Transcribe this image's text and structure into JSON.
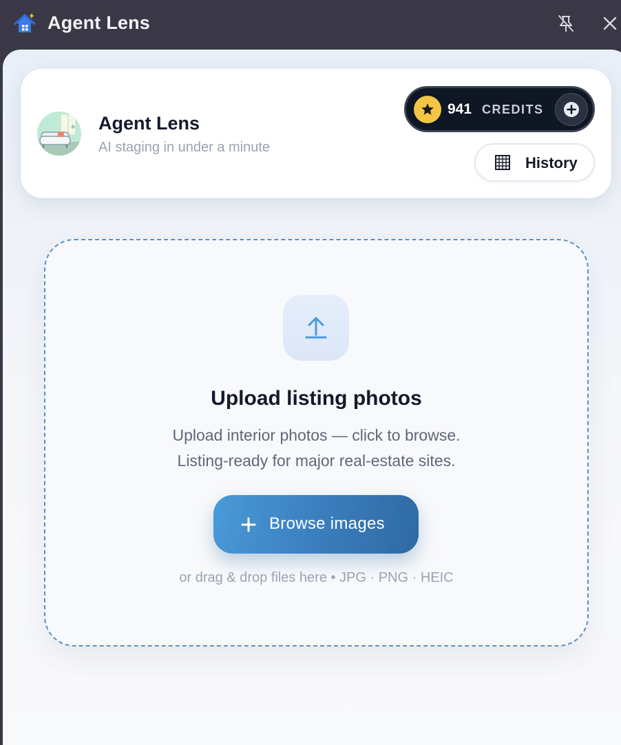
{
  "window": {
    "title": "Agent Lens"
  },
  "header": {
    "brand_name": "Agent Lens",
    "tagline": "AI staging in under a minute",
    "credits": {
      "count": "941",
      "label": "CREDITS"
    },
    "history_label": "History"
  },
  "upload": {
    "title": "Upload listing photos",
    "description_line1": "Upload interior photos — click to browse.",
    "description_line2": "Listing-ready for major real-estate sites.",
    "browse_label": "Browse images",
    "hint": "or drag & drop files here • JPG · PNG · HEIC"
  },
  "colors": {
    "titlebar": "#3a3846",
    "accent": "#3a7cbc",
    "credits_pill": "#0f1624",
    "coin": "#f3c544",
    "dropzone_border": "#5a8fc4"
  },
  "icons": [
    "app-house-icon",
    "unpin-icon",
    "close-icon",
    "star-icon",
    "plus-circle-icon",
    "grid-icon",
    "upload-arrow-icon",
    "plus-icon"
  ]
}
